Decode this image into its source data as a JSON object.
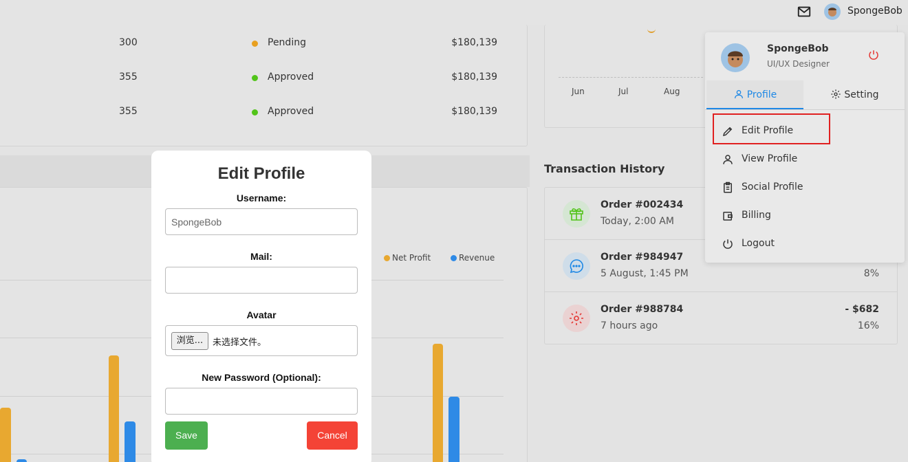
{
  "header": {
    "username": "SpongeBob"
  },
  "orders_table": {
    "rows": [
      {
        "qty": "300",
        "status": "Pending",
        "status_color": "#e8a020",
        "amount": "$180,139"
      },
      {
        "qty": "355",
        "status": "Approved",
        "status_color": "#52c41a",
        "amount": "$180,139"
      },
      {
        "qty": "355",
        "status": "Approved",
        "status_color": "#52c41a",
        "amount": "$180,139"
      }
    ]
  },
  "chart_data": [
    {
      "type": "bar",
      "legend": [
        "Net Profit",
        "Revenue"
      ],
      "colors": {
        "net_profit": "#e8a830",
        "revenue": "#2e8ae6"
      }
    },
    {
      "type": "line",
      "categories": [
        "Jun",
        "Jul",
        "Aug"
      ]
    }
  ],
  "bar_legend": {
    "net_profit": "Net Profit",
    "revenue": "Revenue"
  },
  "line_chart": {
    "months": [
      "Jun",
      "Jul",
      "Aug"
    ]
  },
  "transactions": {
    "title": "Transaction History",
    "items": [
      {
        "order": "Order #002434",
        "time": "Today, 2:00 AM",
        "amount": "",
        "percent": "",
        "icon": "gift-icon",
        "icon_bg": "#d5e6d3",
        "icon_color": "#52c41a"
      },
      {
        "order": "Order #984947",
        "time": "5 August, 1:45 PM",
        "amount": "",
        "percent": "8%",
        "icon": "message-icon",
        "icon_bg": "#cfdde9",
        "icon_color": "#1e88e5"
      },
      {
        "order": "Order #988784",
        "time": "7 hours ago",
        "amount": "- $682",
        "percent": "16%",
        "icon": "gear-icon",
        "icon_bg": "#ead2d2",
        "icon_color": "#e53935"
      }
    ]
  },
  "modal": {
    "title": "Edit Profile",
    "username_label": "Username:",
    "username_placeholder": "SpongeBob",
    "mail_label": "Mail:",
    "avatar_label": "Avatar",
    "browse_label": "浏览...",
    "no_file_text": "未选择文件。",
    "password_label": "New Password (Optional):",
    "save_label": "Save",
    "cancel_label": "Cancel"
  },
  "profile_menu": {
    "name": "SpongeBob",
    "role": "UI/UX Designer",
    "tabs": [
      {
        "label": "Profile"
      },
      {
        "label": "Setting"
      }
    ],
    "items": [
      {
        "label": "Edit Profile",
        "icon": "pencil-icon"
      },
      {
        "label": "View Profile",
        "icon": "user-icon"
      },
      {
        "label": "Social Profile",
        "icon": "clipboard-icon"
      },
      {
        "label": "Billing",
        "icon": "wallet-icon"
      },
      {
        "label": "Logout",
        "icon": "power-icon"
      }
    ]
  }
}
